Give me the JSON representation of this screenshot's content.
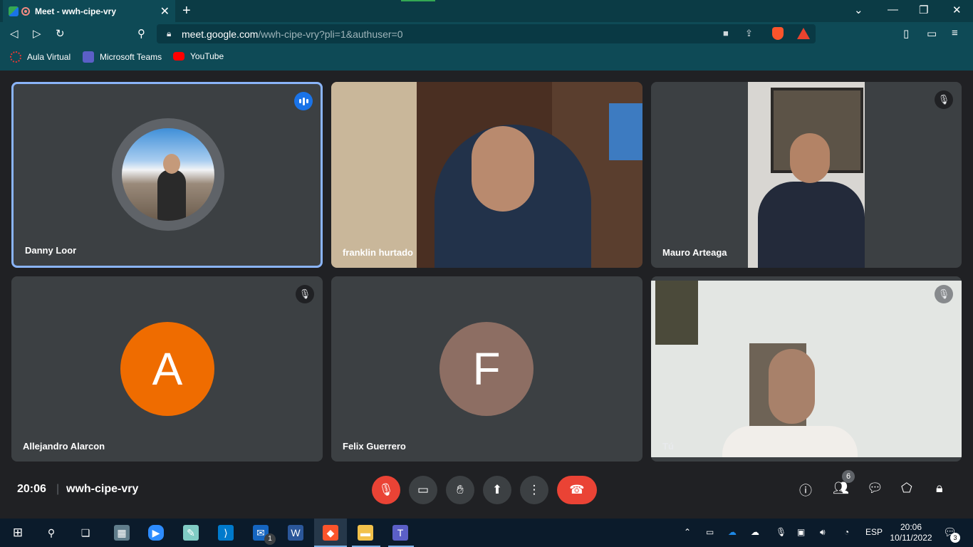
{
  "browser": {
    "tab_title": "Meet - wwh-cipe-vry",
    "tab_close": "✕",
    "new_tab": "+",
    "url_host": "meet.google.com",
    "url_path": "/wwh-cipe-vry?pli=1&authuser=0",
    "bookmarks": [
      "Aula Virtual",
      "Microsoft Teams",
      "YouTube"
    ]
  },
  "meet": {
    "participants": [
      {
        "name": "Danny Loor",
        "state": "speaking"
      },
      {
        "name": "franklin hurtado",
        "state": "video"
      },
      {
        "name": "Mauro Arteaga",
        "state": "muted-video"
      },
      {
        "name": "Allejandro Alarcon",
        "state": "muted",
        "initial": "A",
        "color": "#ef6c00"
      },
      {
        "name": "Felix Guerrero",
        "state": "avatar",
        "initial": "F",
        "color": "#8d6e63"
      },
      {
        "name": "Tú",
        "state": "muted-video"
      }
    ],
    "meeting_time": "20:06",
    "separator": "|",
    "meeting_code": "wwh-cipe-vry",
    "participant_count": "6"
  },
  "taskbar": {
    "language": "ESP",
    "time": "20:06",
    "date": "10/11/2022",
    "notifications": "3",
    "mail_badge": "1"
  },
  "colors": {
    "accent_blue": "#1a73e8",
    "end_call_red": "#ea4335",
    "tile_bg": "#3c4043",
    "meet_bg": "#202124"
  }
}
